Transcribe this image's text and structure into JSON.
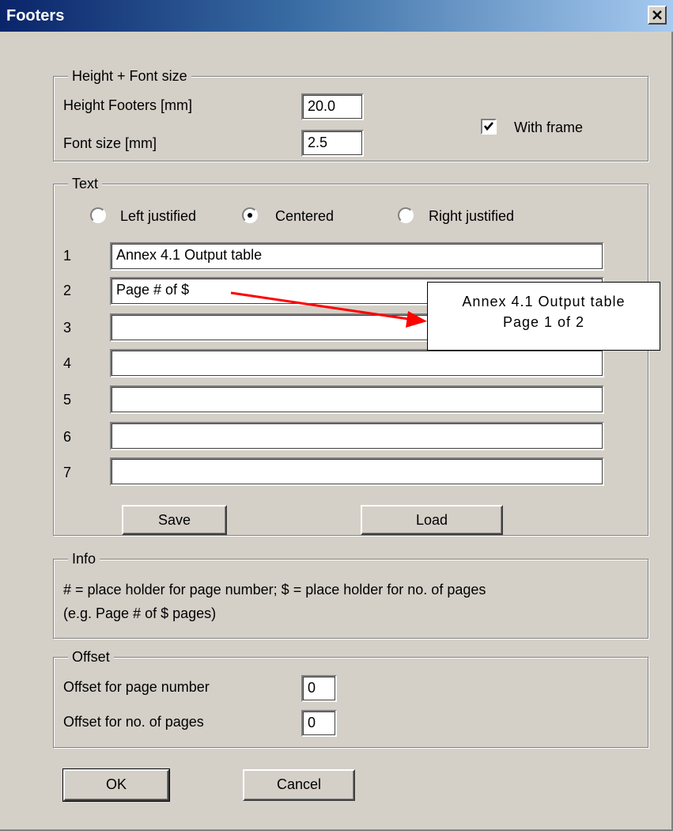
{
  "window": {
    "title": "Footers"
  },
  "height_font": {
    "legend": "Height + Font size",
    "height_label": "Height Footers [mm]",
    "height_value": "20.0",
    "font_label": "Font size [mm]",
    "font_value": "2.5",
    "with_frame_label": "With frame",
    "with_frame_checked": true
  },
  "text": {
    "legend": "Text",
    "alignment": [
      {
        "label": "Left justified",
        "selected": false
      },
      {
        "label": "Centered",
        "selected": true
      },
      {
        "label": "Right justified",
        "selected": false
      }
    ],
    "lines": [
      {
        "number": "1",
        "value": "Annex 4.1 Output table"
      },
      {
        "number": "2",
        "value": "Page # of $"
      },
      {
        "number": "3",
        "value": ""
      },
      {
        "number": "4",
        "value": ""
      },
      {
        "number": "5",
        "value": ""
      },
      {
        "number": "6",
        "value": ""
      },
      {
        "number": "7",
        "value": ""
      }
    ],
    "save_label": "Save",
    "load_label": "Load"
  },
  "callout": {
    "line1": "Annex 4.1 Output table",
    "line2": "Page 1 of 2",
    "arrow_color": "#ff0000"
  },
  "info": {
    "legend": "Info",
    "line1": "# = place holder for page number; $ = place holder for no. of pages",
    "line2": "(e.g. Page # of $ pages)"
  },
  "offset": {
    "legend": "Offset",
    "page_number_label": "Offset for page number",
    "page_number_value": "0",
    "pages_label": "Offset for no. of pages",
    "pages_value": "0"
  },
  "buttons": {
    "ok": "OK",
    "cancel": "Cancel"
  }
}
